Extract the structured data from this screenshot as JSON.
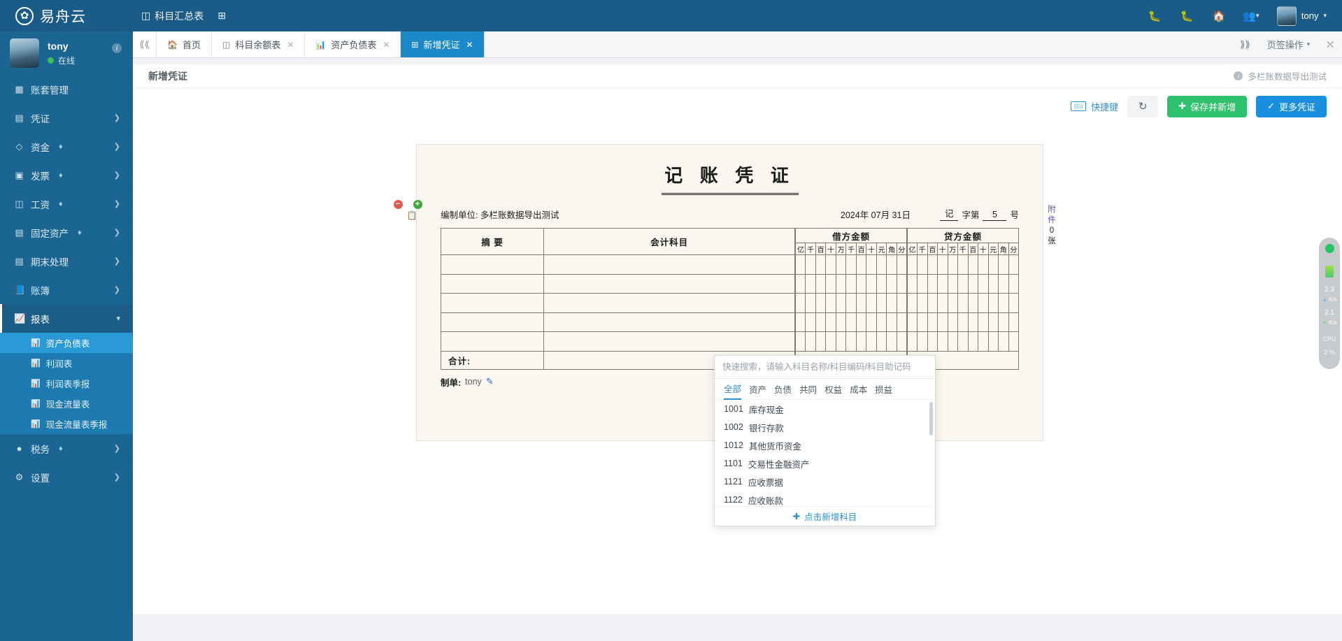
{
  "header": {
    "brand": "易舟云",
    "brand_icon": "leaf-circle-icon",
    "menu": [
      {
        "label": "科目汇总表",
        "icon": "table-icon"
      }
    ],
    "add_icon": "grid-plus-icon",
    "right_icons": [
      "bug-icon",
      "bug-alt-icon",
      "home-icon",
      "users-icon"
    ],
    "user_name": "tony"
  },
  "sidebar": {
    "user": {
      "name": "tony",
      "status": "在线",
      "info_icon": "info-icon"
    },
    "items": [
      {
        "label": "账套管理",
        "icon": "book-icon",
        "vip": false,
        "arrow": false,
        "active": false
      },
      {
        "label": "凭证",
        "icon": "voucher-icon",
        "vip": false,
        "arrow": true,
        "active": false
      },
      {
        "label": "资金",
        "icon": "funds-icon",
        "vip": true,
        "arrow": true,
        "active": false
      },
      {
        "label": "发票",
        "icon": "invoice-icon",
        "vip": true,
        "arrow": true,
        "active": false
      },
      {
        "label": "工资",
        "icon": "salary-icon",
        "vip": true,
        "arrow": true,
        "active": false
      },
      {
        "label": "固定资产",
        "icon": "asset-icon",
        "vip": true,
        "arrow": true,
        "active": false
      },
      {
        "label": "期末处理",
        "icon": "calendar-icon",
        "vip": false,
        "arrow": true,
        "active": false
      },
      {
        "label": "账簿",
        "icon": "ledger-icon",
        "vip": false,
        "arrow": true,
        "active": false
      },
      {
        "label": "报表",
        "icon": "chart-line-icon",
        "vip": false,
        "arrow": true,
        "active": true
      }
    ],
    "sub_items": [
      {
        "label": "资产负债表",
        "icon": "area-chart-icon",
        "active": true
      },
      {
        "label": "利润表",
        "icon": "bar-chart-icon",
        "active": false
      },
      {
        "label": "利润表季报",
        "icon": "bar-chart-icon",
        "active": false
      },
      {
        "label": "现金流量表",
        "icon": "bar-chart-icon",
        "active": false
      },
      {
        "label": "现金流量表季报",
        "icon": "bar-chart-icon",
        "active": false
      }
    ],
    "items_bottom": [
      {
        "label": "税务",
        "icon": "tax-icon",
        "vip": true,
        "arrow": true
      },
      {
        "label": "设置",
        "icon": "gear-icon",
        "vip": false,
        "arrow": true
      }
    ]
  },
  "tabbar": {
    "prev_icon": "double-chevron-left-icon",
    "next_icon": "double-chevron-right-icon",
    "tabs": [
      {
        "label": "首页",
        "icon": "home-icon",
        "closable": false,
        "active": false
      },
      {
        "label": "科目余额表",
        "icon": "table-icon",
        "closable": true,
        "active": false
      },
      {
        "label": "资产负债表",
        "icon": "area-chart-icon",
        "closable": true,
        "active": false
      },
      {
        "label": "新增凭证",
        "icon": "plus-square-icon",
        "closable": true,
        "active": true
      }
    ],
    "ops_label": "页签操作",
    "fullscreen_icon": "fullscreen-icon"
  },
  "page_head": {
    "title": "新增凭证",
    "account_set": "多栏账数据导出测试",
    "info_icon": "info-icon"
  },
  "toolbar": {
    "shortcut_label": "快捷键",
    "shortcut_icon": "keyboard-icon",
    "refresh_icon": "refresh-icon",
    "save_new_label": "保存并新增",
    "save_new_icon": "plus-icon",
    "more_label": "更多凭证",
    "more_icon": "check-circle-icon",
    "green": "#2fc26e",
    "blue": "#1a8fe0"
  },
  "voucher": {
    "title": "记 账 凭 证",
    "unit_label": "编制单位:",
    "unit_value": "多栏账数据导出测试",
    "date": "2024年 07月 31日",
    "word": "记",
    "word_suffix": "字第",
    "number": "5",
    "number_suffix": "号",
    "columns": {
      "summary": "摘 要",
      "account": "会计科目",
      "debit": "借方金额",
      "credit": "贷方金额"
    },
    "digits": [
      "亿",
      "千",
      "百",
      "十",
      "万",
      "千",
      "百",
      "十",
      "元",
      "角",
      "分"
    ],
    "rows": [
      {
        "summary": "",
        "account": "",
        "debit": "",
        "credit": ""
      },
      {
        "summary": "",
        "account": "",
        "debit": "",
        "credit": ""
      },
      {
        "summary": "",
        "account": "",
        "debit": "",
        "credit": ""
      },
      {
        "summary": "",
        "account": "",
        "debit": "",
        "credit": ""
      },
      {
        "summary": "",
        "account": "",
        "debit": "",
        "credit": ""
      }
    ],
    "total_label": "合计:",
    "maker_label": "制单:",
    "maker_name": "tony",
    "edit_icon": "edit-icon",
    "attachment": {
      "label": "附件",
      "count": "0",
      "unit": "张"
    },
    "row_controls": {
      "remove_icon": "minus-circle-icon",
      "add_icon": "plus-circle-icon",
      "copy_icon": "copy-icon"
    }
  },
  "account_dropdown": {
    "search_placeholder": "快速搜索，请输入科目名称/科目编码/科目助记码",
    "search_value": "",
    "tabs": [
      "全部",
      "资产",
      "负债",
      "共同",
      "权益",
      "成本",
      "损益"
    ],
    "active_tab": "全部",
    "items": [
      {
        "code": "1001",
        "name": "库存现金"
      },
      {
        "code": "1002",
        "name": "银行存款"
      },
      {
        "code": "1012",
        "name": "其他货币资金"
      },
      {
        "code": "1101",
        "name": "交易性金融资产"
      },
      {
        "code": "1121",
        "name": "应收票据"
      },
      {
        "code": "1122",
        "name": "应收账款"
      }
    ],
    "footer_label": "点击新增科目",
    "footer_icon": "plus-icon"
  },
  "perf_widget": {
    "upload_value": "2.3",
    "upload_unit": "K/s",
    "download_value": "2.1",
    "download_unit": "K/s",
    "cpu_label": "CPU",
    "cpu_value": "2 %"
  }
}
